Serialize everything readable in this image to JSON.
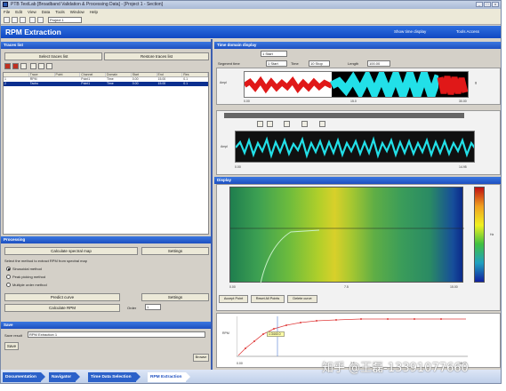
{
  "window": {
    "title": "PTB TestLab  [Broadband Validation & Processing Data] - [Project 1 - Section]",
    "buttons": [
      "_",
      "□",
      "x"
    ]
  },
  "menu": [
    "File",
    "Edit",
    "View",
    "Data",
    "Tools",
    "Window",
    "Help"
  ],
  "toolbar": {
    "combo_value": "Project 1"
  },
  "header": {
    "title": "RPM Extraction",
    "link_show": "Show time display",
    "link_help": "Tools Access",
    "link_detail": "Show Detail Region"
  },
  "left": {
    "traces_title": "Traces list",
    "btn_select": "Select traces list",
    "btn_restore": "Restore traces list",
    "grid_cols": [
      "",
      "Trace",
      "Point",
      "Channel",
      "Domain",
      "Start",
      "End",
      "Res"
    ],
    "grid_rows": [
      [
        "1",
        "RPM",
        "",
        "Point1",
        "Time",
        "0.00",
        "15.00",
        "0.1"
      ],
      [
        "2",
        "Tacho",
        "",
        "Point1",
        "Time",
        "0.00",
        "15.00",
        "0.1"
      ]
    ],
    "processing_title": "Processing",
    "btn_calculate_spectral": "Calculate spectral map",
    "btn_settings": "Settings",
    "note": "Select the method to extract RPM from spectral map",
    "methods": [
      "Sinusoidal method",
      "Peak picking method",
      "Multiple order method"
    ],
    "btn_predict": "Predict curve",
    "btn_settings2": "Settings",
    "btn_calculate_rpm": "Calculate RPM",
    "order_label": "Order",
    "order_value": "1",
    "save_title": "Save",
    "save_label": "Save result",
    "save_value": "RPM Extraction 1",
    "btn_save": "Save",
    "btn_browse": "Browse"
  },
  "right": {
    "time_title": "Time domain display",
    "segment_label": "Segment time",
    "time_fields": [
      "1 Start",
      "Time",
      "10 Stop",
      "Length",
      "100.00"
    ],
    "overview_y": "Ampl",
    "overview_y2": "g",
    "overview_x": [
      "0.00",
      "15.0",
      "30.00"
    ],
    "detail_x": [
      "0.00",
      "14.95"
    ],
    "detail_y": "Ampl",
    "spectral_title": "Display",
    "spec_x": [
      "0.00",
      "7.5",
      "15.00"
    ],
    "spec_y": "Hz",
    "spec_btns": [
      "Accept Point",
      "Reset All Points",
      "Delete curve"
    ],
    "rpm_y": "RPM",
    "rpm_x": [
      "0.00",
      "7.5",
      "15.00"
    ],
    "rpm_marker": "1:3440.0"
  },
  "bottomnav": [
    "Documentation",
    "Navigator",
    "Time Data Selection",
    "RPM Extraction"
  ],
  "watermark": "知乎 @王磊-13391077660",
  "colors": {
    "accent": "#1d4fc0",
    "signal_cyan": "#22e0e8",
    "signal_red": "#e01818"
  }
}
